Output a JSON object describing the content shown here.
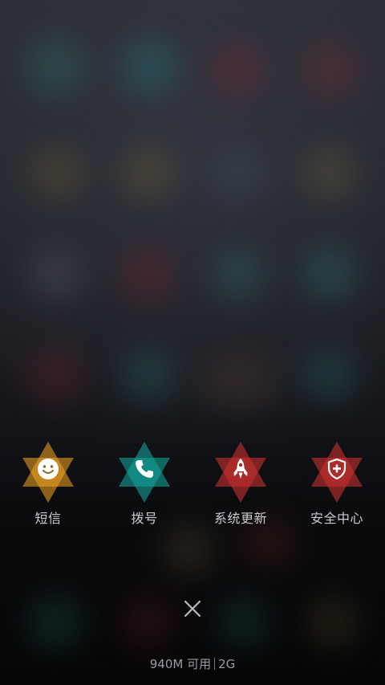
{
  "shortcuts": [
    {
      "id": "messages",
      "label": "短信",
      "icon": "smiley-face-icon",
      "color": "#F5A623"
    },
    {
      "id": "dialer",
      "label": "拨号",
      "icon": "phone-icon",
      "color": "#14A098"
    },
    {
      "id": "update",
      "label": "系统更新",
      "icon": "rocket-icon",
      "color": "#C8302F"
    },
    {
      "id": "security",
      "label": "安全中心",
      "icon": "shield-plus-icon",
      "color": "#C8302F"
    }
  ],
  "close": {
    "icon": "close-icon"
  },
  "memory": {
    "available": "940M 可用",
    "network": "2G"
  }
}
